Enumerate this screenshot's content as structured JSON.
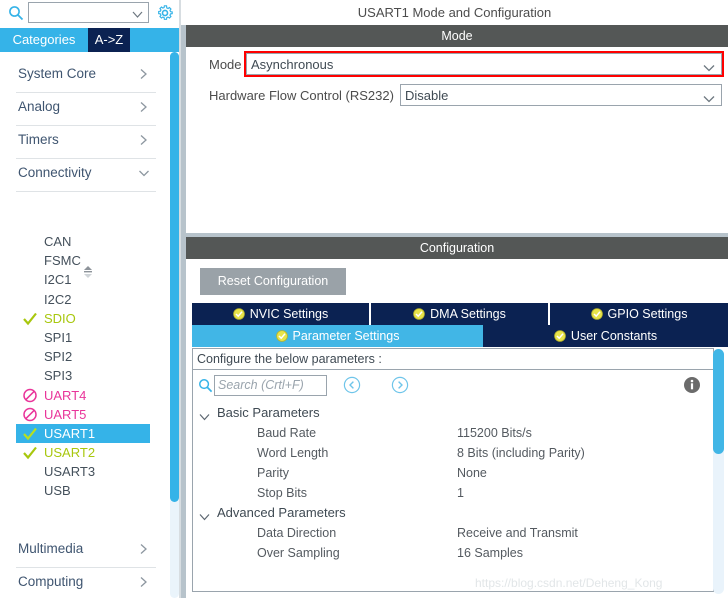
{
  "sidebar": {
    "search": {
      "value": "",
      "placeholder": ""
    },
    "gear_icon": "gear-icon",
    "search_icon": "search-icon",
    "tabs": [
      {
        "label": "Categories",
        "active": true
      },
      {
        "label": "A->Z",
        "active": false
      }
    ],
    "categories": [
      {
        "label": "System Core",
        "expanded": false
      },
      {
        "label": "Analog",
        "expanded": false
      },
      {
        "label": "Timers",
        "expanded": false
      },
      {
        "label": "Connectivity",
        "expanded": true
      }
    ],
    "peripherals": [
      {
        "label": "CAN",
        "state": "none"
      },
      {
        "label": "FSMC",
        "state": "none"
      },
      {
        "label": "I2C1",
        "state": "none"
      },
      {
        "label": "I2C2",
        "state": "none"
      },
      {
        "label": "SDIO",
        "state": "ok"
      },
      {
        "label": "SPI1",
        "state": "none"
      },
      {
        "label": "SPI2",
        "state": "none"
      },
      {
        "label": "SPI3",
        "state": "none"
      },
      {
        "label": "UART4",
        "state": "blocked"
      },
      {
        "label": "UART5",
        "state": "blocked"
      },
      {
        "label": "USART1",
        "state": "ok",
        "selected": true
      },
      {
        "label": "USART2",
        "state": "ok"
      },
      {
        "label": "USART3",
        "state": "none"
      },
      {
        "label": "USB",
        "state": "none"
      }
    ],
    "categories_bottom": [
      {
        "label": "Multimedia",
        "expanded": false
      },
      {
        "label": "Computing",
        "expanded": false
      }
    ]
  },
  "main": {
    "title": "USART1 Mode and Configuration",
    "mode_section": {
      "band": "Mode",
      "fields": [
        {
          "label": "Mode",
          "value": "Asynchronous",
          "highlighted": true
        },
        {
          "label": "Hardware Flow Control (RS232)",
          "value": "Disable",
          "highlighted": false
        }
      ]
    },
    "configuration_section": {
      "band": "Configuration",
      "reset_button": "Reset Configuration",
      "tabs_row1": [
        {
          "label": "NVIC Settings",
          "active": false
        },
        {
          "label": "DMA Settings",
          "active": false
        },
        {
          "label": "GPIO Settings",
          "active": false
        }
      ],
      "tabs_row2": [
        {
          "label": "Parameter Settings",
          "active": true
        },
        {
          "label": "User Constants",
          "active": false
        }
      ],
      "panel_header": "Configure the below parameters :",
      "search": {
        "value": "",
        "placeholder": "Search (Crtl+F)"
      },
      "nav_prev_icon": "chevron-left-circle-icon",
      "nav_next_icon": "chevron-right-circle-icon",
      "info_icon": "info-icon",
      "groups": [
        {
          "label": "Basic Parameters",
          "expanded": true,
          "rows": [
            {
              "name": "Baud Rate",
              "value": "115200 Bits/s"
            },
            {
              "name": "Word Length",
              "value": "8 Bits (including Parity)"
            },
            {
              "name": "Parity",
              "value": "None"
            },
            {
              "name": "Stop Bits",
              "value": "1"
            }
          ]
        },
        {
          "label": "Advanced Parameters",
          "expanded": true,
          "rows": [
            {
              "name": "Data Direction",
              "value": "Receive and Transmit"
            },
            {
              "name": "Over Sampling",
              "value": "16 Samples"
            }
          ]
        }
      ]
    }
  },
  "watermark": "https://blog.csdn.net/Deheng_Kong",
  "colors": {
    "accent_blue": "#35b3e8",
    "tab_navy": "#0b2252",
    "band_gray": "#545756",
    "panel_bg": "#b7c3cb",
    "enabled_green": "#a8c70e",
    "blocked_pink": "#e9359a",
    "highlight_red": "#ff0000"
  }
}
